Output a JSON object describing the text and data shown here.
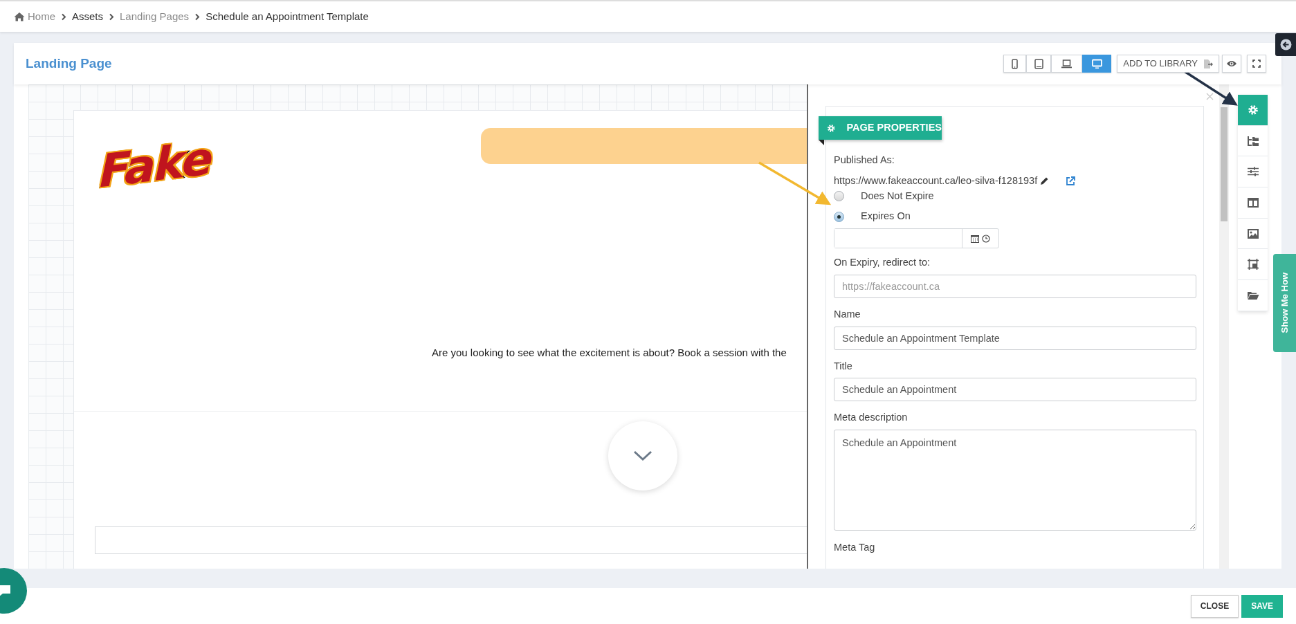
{
  "breadcrumb": [
    {
      "label": "Home",
      "kind": "home",
      "muted": true
    },
    {
      "label": "Assets",
      "muted": false
    },
    {
      "label": "Landing Pages",
      "muted": true
    },
    {
      "label": "Schedule an Appointment Template",
      "muted": false
    }
  ],
  "header": {
    "title": "Landing Page",
    "device_buttons": [
      {
        "kind": "phone",
        "selected": false
      },
      {
        "kind": "tablet",
        "selected": false
      },
      {
        "kind": "laptop",
        "selected": false
      },
      {
        "kind": "desktop",
        "selected": true
      }
    ],
    "add_to_library": "ADD TO LIBRARY"
  },
  "canvas": {
    "logo": "Fake",
    "body_text": "Are you looking to see what the excitement is about? Book a session with the"
  },
  "panel": {
    "heading": "PAGE PROPERTIES",
    "published_label": "Published As:",
    "published_url": "https://www.fakeaccount.ca/leo-silva-f128193f",
    "expiry_options": [
      {
        "label": "Does Not Expire",
        "selected": false
      },
      {
        "label": "Expires On",
        "selected": true
      }
    ],
    "redirect_label": "On Expiry, redirect to:",
    "redirect_placeholder": "https://fakeaccount.ca",
    "fields": [
      {
        "label": "Name",
        "value": "Schedule an Appointment Template",
        "kind": "input"
      },
      {
        "label": "Title",
        "value": "Schedule an Appointment",
        "kind": "input"
      },
      {
        "label": "Meta description",
        "value": "Schedule an Appointment",
        "kind": "textarea"
      }
    ],
    "next_label": "Meta Tag"
  },
  "side_tools": [
    {
      "kind": "settings",
      "selected": true
    },
    {
      "kind": "tree",
      "selected": false
    },
    {
      "kind": "sliders",
      "selected": false
    },
    {
      "kind": "columns",
      "selected": false
    },
    {
      "kind": "image",
      "selected": false
    },
    {
      "kind": "crop",
      "selected": false
    },
    {
      "kind": "folder",
      "selected": false
    }
  ],
  "help_tab": "Show Me How",
  "footer": {
    "buttons": [
      {
        "label": "CLOSE",
        "kind": "secondary"
      },
      {
        "label": "SAVE",
        "kind": "primary"
      }
    ]
  }
}
